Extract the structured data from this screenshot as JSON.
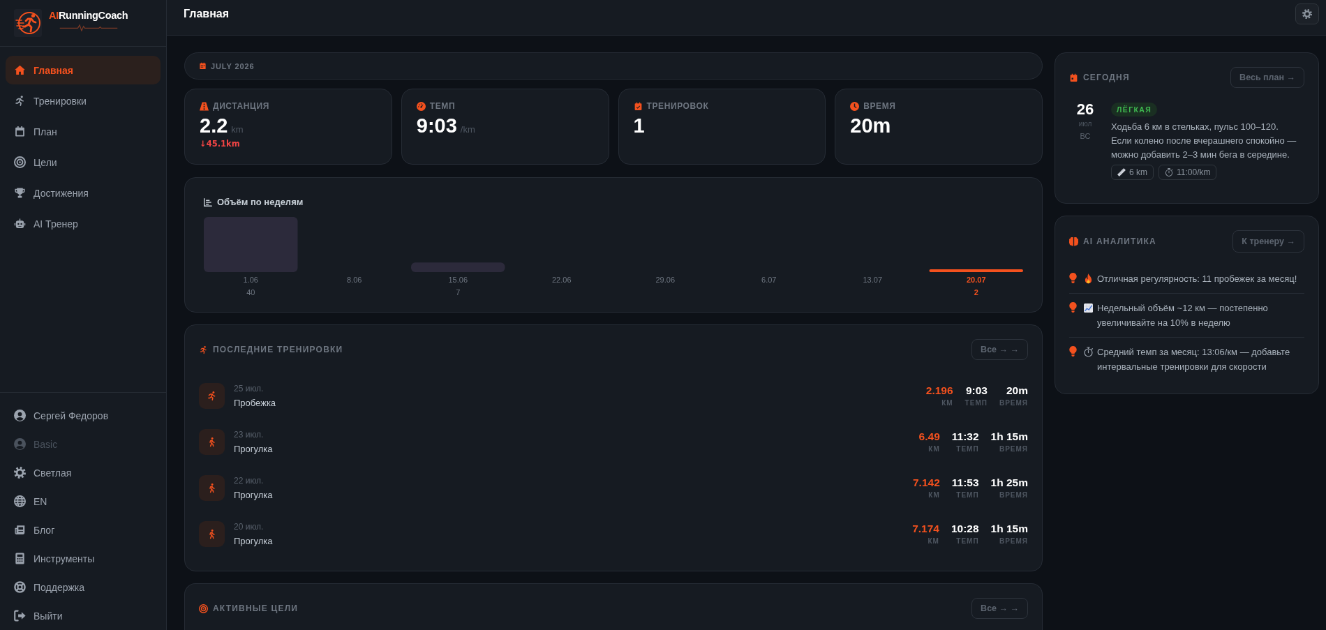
{
  "sidebar": {
    "logo": {
      "accent": "AI",
      "text": "RunningCoach"
    },
    "nav": [
      {
        "label": "Главная",
        "selected": true
      },
      {
        "label": "Тренировки",
        "selected": false
      },
      {
        "label": "План",
        "selected": false
      },
      {
        "label": "Цели",
        "selected": false
      },
      {
        "label": "Достижения",
        "selected": false
      },
      {
        "label": "AI Тренер",
        "selected": false
      }
    ],
    "footer": [
      {
        "label": "Сергей Федоров",
        "disabled": false
      },
      {
        "label": "Basic",
        "disabled": true
      },
      {
        "label": "Светлая",
        "disabled": false
      },
      {
        "label": "EN",
        "disabled": false
      },
      {
        "label": "Блог",
        "disabled": false
      },
      {
        "label": "Инструменты",
        "disabled": false
      },
      {
        "label": "Поддержка",
        "disabled": false
      },
      {
        "label": "Выйти",
        "disabled": false
      }
    ]
  },
  "header": {
    "title": "Главная"
  },
  "month": {
    "label": "JULY 2026"
  },
  "stats": [
    {
      "label": "ДИСТАНЦИЯ",
      "value": "2.2",
      "unit": "km",
      "delta": "↓45.1km"
    },
    {
      "label": "ТЕМП",
      "value": "9:03",
      "unit": "/km"
    },
    {
      "label": "ТРЕНИРОВОК",
      "value": "1"
    },
    {
      "label": "ВРЕМЯ",
      "value": "20m"
    }
  ],
  "weekly_chart": {
    "chart_data": {
      "type": "bar",
      "title": "Объём по неделям",
      "categories": [
        "1.06",
        "8.06",
        "15.06",
        "22.06",
        "29.06",
        "6.07",
        "13.07",
        "20.07"
      ],
      "series": [
        {
          "color": "#2c2a3b",
          "values": [
            40,
            null,
            7,
            null,
            null,
            null,
            null,
            null
          ]
        },
        {
          "color": "#f4511e",
          "values": [
            null,
            null,
            null,
            null,
            null,
            null,
            null,
            2
          ]
        }
      ],
      "stacked": true,
      "data_labels": true
    }
  },
  "recent_workouts": {
    "title": "ПОСЛЕДНИЕ ТРЕНИРОВКИ",
    "button": "Все → →",
    "rows": [
      {
        "kind": "run",
        "date": "25 июл.",
        "name": "Пробежка",
        "stats": [
          {
            "value": "2.196",
            "label": "КМ"
          },
          {
            "value": "9:03",
            "label": "ТЕМП"
          },
          {
            "value": "20m",
            "label": "ВРЕМЯ"
          }
        ]
      },
      {
        "kind": "walk",
        "date": "23 июл.",
        "name": "Прогулка",
        "stats": [
          {
            "value": "6.49",
            "label": "КМ"
          },
          {
            "value": "11:32",
            "label": "ТЕМП"
          },
          {
            "value": "1h 15m",
            "label": "ВРЕМЯ"
          }
        ]
      },
      {
        "kind": "walk",
        "date": "22 июл.",
        "name": "Прогулка",
        "stats": [
          {
            "value": "7.142",
            "label": "КМ"
          },
          {
            "value": "11:53",
            "label": "ТЕМП"
          },
          {
            "value": "1h 25m",
            "label": "ВРЕМЯ"
          }
        ]
      },
      {
        "kind": "walk",
        "date": "20 июл.",
        "name": "Прогулка",
        "stats": [
          {
            "value": "7.174",
            "label": "КМ"
          },
          {
            "value": "10:28",
            "label": "ТЕМП"
          },
          {
            "value": "1h 15m",
            "label": "ВРЕМЯ"
          }
        ]
      }
    ]
  },
  "active_goals": {
    "title": "АКТИВНЫЕ ЦЕЛИ",
    "button": "Все → →"
  },
  "today": {
    "title": "СЕГОДНЯ",
    "button": "Весь план →",
    "day": "26",
    "month": "июл",
    "weekday": "ВС",
    "badge": {
      "text": "ЛЁГКАЯ",
      "kind": "easy"
    },
    "description": "Ходьба 6 км в стельках, пульс 100–120. Если колено после вчерашнего спокойно — можно добавить 2–3 мин бега в середине.",
    "chips": [
      {
        "kind": "distance",
        "text": "6 km"
      },
      {
        "kind": "pace",
        "text": "11:00/km"
      }
    ]
  },
  "ai_insights": {
    "title": "AI АНАЛИТИКА",
    "button": "К тренеру →",
    "items": [
      {
        "kind": "regularity",
        "text": "Отличная регулярность: 11 пробежек за месяц!"
      },
      {
        "kind": "volume",
        "text": "Недельный объём ~12 км — постепенно увеличивайте на 10% в неделю"
      },
      {
        "kind": "pace",
        "text": "Средний темп за месяц: 13:06/км — добавьте интервальные тренировки для скорости"
      }
    ]
  }
}
